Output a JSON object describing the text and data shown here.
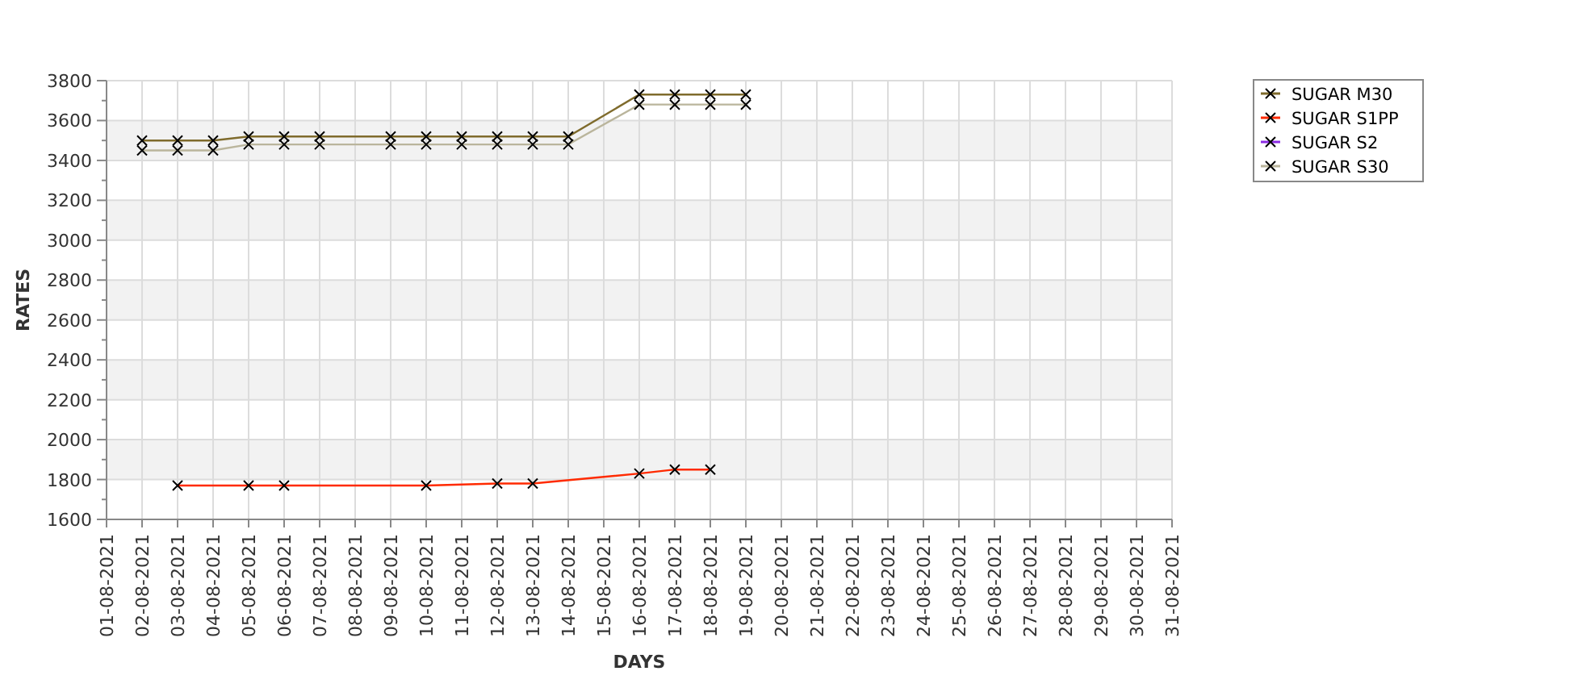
{
  "chart_data": {
    "type": "line",
    "xlabel": "DAYS",
    "ylabel": "RATES",
    "grid": true,
    "legend": true,
    "categories": [
      "01-08-2021",
      "02-08-2021",
      "03-08-2021",
      "04-08-2021",
      "05-08-2021",
      "06-08-2021",
      "07-08-2021",
      "08-08-2021",
      "09-08-2021",
      "10-08-2021",
      "11-08-2021",
      "12-08-2021",
      "13-08-2021",
      "14-08-2021",
      "15-08-2021",
      "16-08-2021",
      "17-08-2021",
      "18-08-2021",
      "19-08-2021",
      "20-08-2021",
      "21-08-2021",
      "22-08-2021",
      "23-08-2021",
      "24-08-2021",
      "25-08-2021",
      "26-08-2021",
      "27-08-2021",
      "28-08-2021",
      "29-08-2021",
      "30-08-2021",
      "31-08-2021"
    ],
    "ylim": [
      1600,
      3800
    ],
    "yticks": [
      1600,
      1800,
      2000,
      2200,
      2400,
      2600,
      2800,
      3000,
      3200,
      3400,
      3600,
      3800
    ],
    "series": [
      {
        "name": "SUGAR M30",
        "color": "#7f6b2c",
        "marker": "x",
        "values": [
          null,
          3500,
          3500,
          3500,
          3520,
          3520,
          3520,
          null,
          3520,
          3520,
          3520,
          3520,
          3520,
          3520,
          null,
          3730,
          3730,
          3730,
          3730,
          null,
          null,
          null,
          null,
          null,
          null,
          null,
          null,
          null,
          null,
          null,
          null
        ]
      },
      {
        "name": "SUGAR S1PP",
        "color": "#ff2a00",
        "marker": "x",
        "values": [
          null,
          null,
          1770,
          null,
          1770,
          1770,
          null,
          null,
          null,
          1770,
          null,
          1780,
          1780,
          null,
          null,
          1830,
          1850,
          1850,
          null,
          null,
          null,
          null,
          null,
          null,
          null,
          null,
          null,
          null,
          null,
          null,
          null
        ]
      },
      {
        "name": "SUGAR S2",
        "color": "#8a2be2",
        "marker": "x",
        "values": [
          null,
          null,
          null,
          null,
          null,
          null,
          null,
          null,
          null,
          null,
          null,
          null,
          null,
          null,
          null,
          null,
          null,
          null,
          null,
          null,
          null,
          null,
          null,
          null,
          null,
          null,
          null,
          null,
          null,
          null,
          null
        ]
      },
      {
        "name": "SUGAR S30",
        "color": "#bab59c",
        "marker": "x",
        "values": [
          null,
          3450,
          3450,
          3450,
          3480,
          3480,
          3480,
          null,
          3480,
          3480,
          3480,
          3480,
          3480,
          3480,
          null,
          3680,
          3680,
          3680,
          3680,
          null,
          null,
          null,
          null,
          null,
          null,
          null,
          null,
          null,
          null,
          null,
          null
        ]
      }
    ]
  }
}
